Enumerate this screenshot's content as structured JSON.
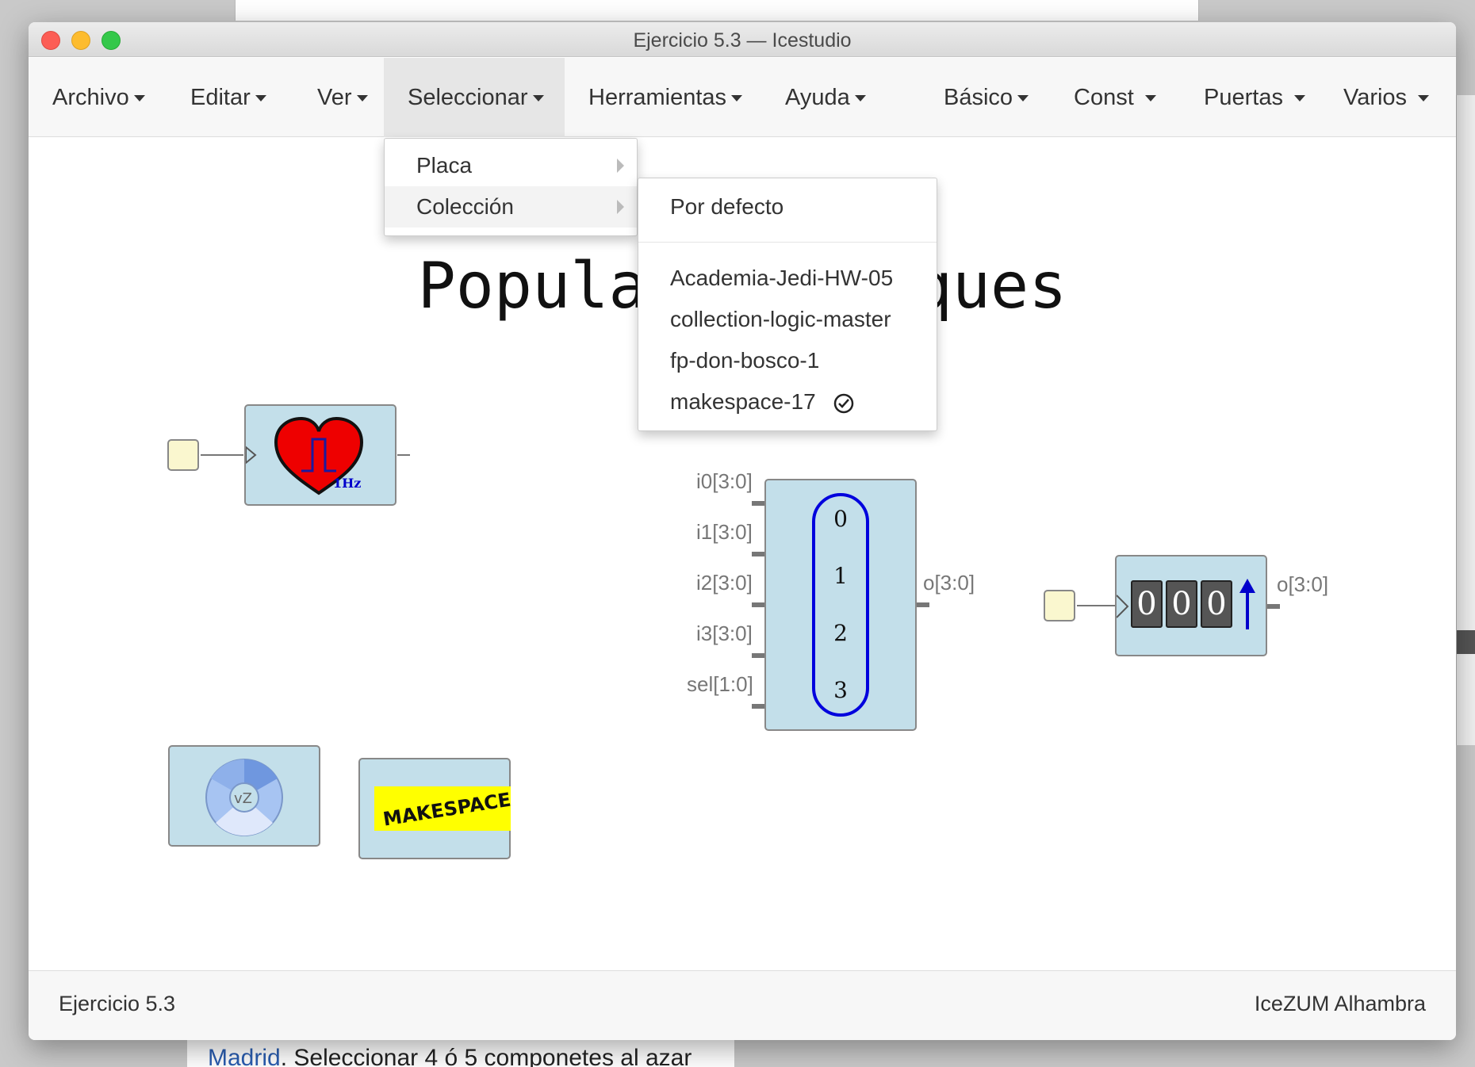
{
  "window": {
    "title": "Ejercicio 5.3 — Icestudio"
  },
  "menubar": {
    "archivo": "Archivo",
    "editar": "Editar",
    "ver": "Ver",
    "seleccionar": "Seleccionar",
    "herramientas": "Herramientas",
    "ayuda": "Ayuda",
    "basico": "Básico",
    "const": "Const",
    "puertas": "Puertas",
    "varios": "Varios"
  },
  "dropdown": {
    "placa": "Placa",
    "coleccion": "Colección"
  },
  "submenu": {
    "default": "Por defecto",
    "items": [
      "Academia-Jedi-HW-05",
      "collection-logic-master",
      "fp-don-bosco-1",
      "makespace-17"
    ],
    "selected_index": 3
  },
  "canvas": {
    "title": "Populando bloques",
    "heart_label": "1Hz",
    "mux": {
      "inputs": [
        "i0[3:0]",
        "i1[3:0]",
        "i2[3:0]",
        "i3[3:0]",
        "sel[1:0]"
      ],
      "output": "o[3:0]",
      "options": [
        "0",
        "1",
        "2",
        "3"
      ]
    },
    "counter": {
      "digits": [
        "0",
        "0",
        "0"
      ],
      "output": "o[3:0]"
    },
    "makespace_logo": "MAKESPACE"
  },
  "status": {
    "left": "Ejercicio 5.3",
    "right": "IceZUM Alhambra"
  },
  "background": {
    "link": "Madrid",
    "text": ". Seleccionar 4 ó 5 componetes al azar"
  },
  "colors": {
    "block_fill": "#c3dfea",
    "input_fill": "#faf7cf",
    "mux_oval": "#0000dd"
  }
}
